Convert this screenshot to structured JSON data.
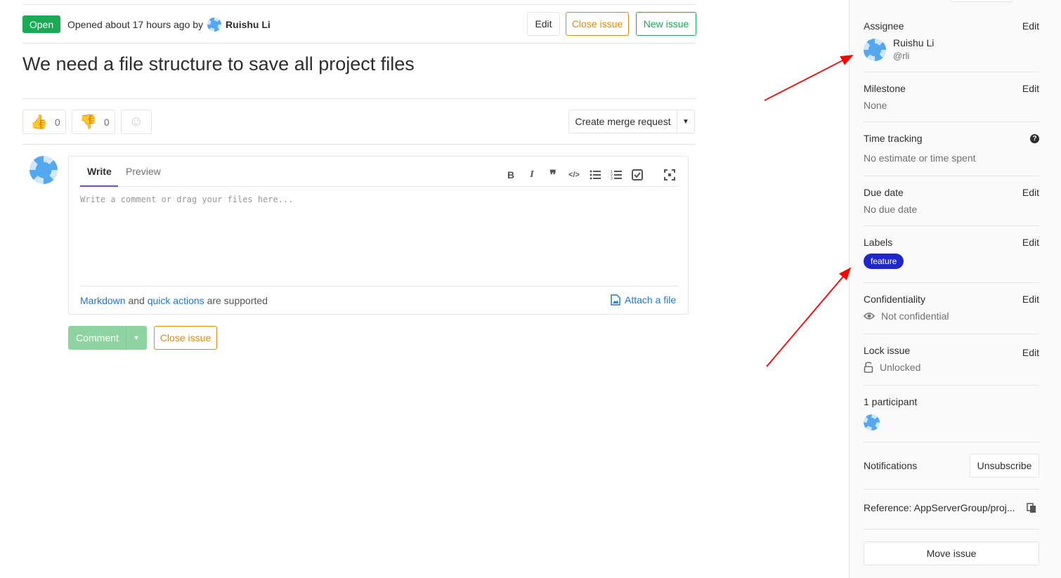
{
  "issue": {
    "status": "Open",
    "opened_text": "Opened about 17 hours ago by",
    "author": "Ruishu Li",
    "title": "We need a file structure to save all project files"
  },
  "header_buttons": {
    "edit": "Edit",
    "close": "Close issue",
    "new": "New issue"
  },
  "awards": {
    "thumbs_up_count": "0",
    "thumbs_down_count": "0"
  },
  "merge_request": {
    "label": "Create merge request"
  },
  "editor": {
    "tab_write": "Write",
    "tab_preview": "Preview",
    "placeholder": "Write a comment or drag your files here...",
    "markdown_link": "Markdown",
    "and_text": "and",
    "quick_actions_link": "quick actions",
    "supported_text": "are supported",
    "attach": "Attach a file"
  },
  "actions": {
    "comment": "Comment",
    "close": "Close issue"
  },
  "sidebar": {
    "assignee": {
      "title": "Assignee",
      "edit": "Edit",
      "name": "Ruishu Li",
      "handle": "@rli"
    },
    "milestone": {
      "title": "Milestone",
      "edit": "Edit",
      "value": "None"
    },
    "time_tracking": {
      "title": "Time tracking",
      "value": "No estimate or time spent"
    },
    "due_date": {
      "title": "Due date",
      "edit": "Edit",
      "value": "No due date"
    },
    "labels": {
      "title": "Labels",
      "edit": "Edit",
      "items": [
        "feature"
      ]
    },
    "confidentiality": {
      "title": "Confidentiality",
      "edit": "Edit",
      "value": "Not confidential"
    },
    "lock": {
      "title": "Lock issue",
      "edit": "Edit",
      "value": "Unlocked"
    },
    "participants": {
      "title": "1 participant"
    },
    "notifications": {
      "title": "Notifications",
      "button": "Unsubscribe"
    },
    "reference": {
      "text": "Reference: AppServerGroup/proj..."
    },
    "move": {
      "button": "Move issue"
    }
  },
  "colors": {
    "open_badge": "#1aaa55",
    "label_feature": "#1f27c9",
    "annotation_arrow": "#ff0000",
    "accent_link": "#1f78d1"
  }
}
